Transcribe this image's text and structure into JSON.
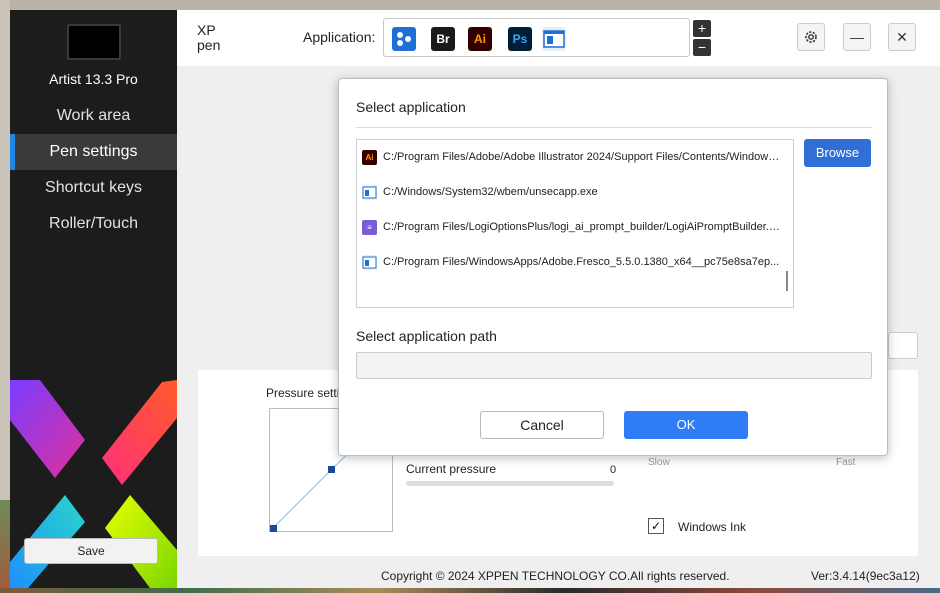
{
  "sidebar": {
    "device_name": "Artist 13.3 Pro",
    "items": [
      {
        "label": "Work area",
        "active": false
      },
      {
        "label": "Pen settings",
        "active": true
      },
      {
        "label": "Shortcut keys",
        "active": false
      },
      {
        "label": "Roller/Touch",
        "active": false
      }
    ],
    "save_label": "Save"
  },
  "header": {
    "logo_text_top": "XP",
    "logo_text_bottom": "pen",
    "application_label": "Application:",
    "apps": [
      {
        "icon": "all-apps-icon",
        "text": "",
        "bg": "#1e6fd6",
        "fg": "#ffffff"
      },
      {
        "icon": "bridge-icon",
        "text": "Br",
        "bg": "#1a1a1a",
        "fg": "#ffffff"
      },
      {
        "icon": "illustrator-icon",
        "text": "Ai",
        "bg": "#330000",
        "fg": "#ff9a00"
      },
      {
        "icon": "photoshop-icon",
        "text": "Ps",
        "bg": "#001e36",
        "fg": "#31a8ff"
      },
      {
        "icon": "generic-window-icon",
        "text": "",
        "bg": "#e6eef8",
        "fg": "#1e6fd6"
      }
    ],
    "plus": "+",
    "minus": "−",
    "settings_icon": "gear-icon",
    "minimize_icon": "minimize-icon",
    "close_icon": "close-icon",
    "minimize_glyph": "—",
    "close_glyph": "✕"
  },
  "pen_panel": {
    "pressure_title": "Pressure setti",
    "current_pressure_label": "Current pressure",
    "current_pressure_value": "0",
    "slow_label": "Slow",
    "fast_label": "Fast",
    "windows_ink_label": "Windows Ink",
    "windows_ink_checked": true,
    "check_glyph": "✓"
  },
  "dialog": {
    "title": "Select application",
    "apps": [
      {
        "icon": "illustrator-icon",
        "glyph": "Ai",
        "bg": "#330000",
        "fg": "#ff9a00",
        "path": "C:/Program Files/Adobe/Adobe Illustrator 2024/Support Files/Contents/Windows..."
      },
      {
        "icon": "window-icon",
        "glyph": "",
        "bg": "#e6eef8",
        "fg": "#1e6fd6",
        "path": "C:/Windows/System32/wbem/unsecapp.exe"
      },
      {
        "icon": "logi-prompt-icon",
        "glyph": "≡",
        "bg": "#7b5cd6",
        "fg": "#ffffff",
        "path": "C:/Program Files/LogiOptionsPlus/logi_ai_prompt_builder/LogiAiPromptBuilder.exe"
      },
      {
        "icon": "window-icon",
        "glyph": "",
        "bg": "#e6eef8",
        "fg": "#1e6fd6",
        "path": "C:/Program Files/WindowsApps/Adobe.Fresco_5.5.0.1380_x64__pc75e8sa7ep..."
      }
    ],
    "browse_label": "Browse",
    "path_label": "Select application path",
    "path_value": "",
    "cancel_label": "Cancel",
    "ok_label": "OK"
  },
  "footer": {
    "copyright": "Copyright © 2024  XPPEN TECHNOLOGY CO.All rights reserved.",
    "version": "Ver:3.4.14(9ec3a12)"
  }
}
